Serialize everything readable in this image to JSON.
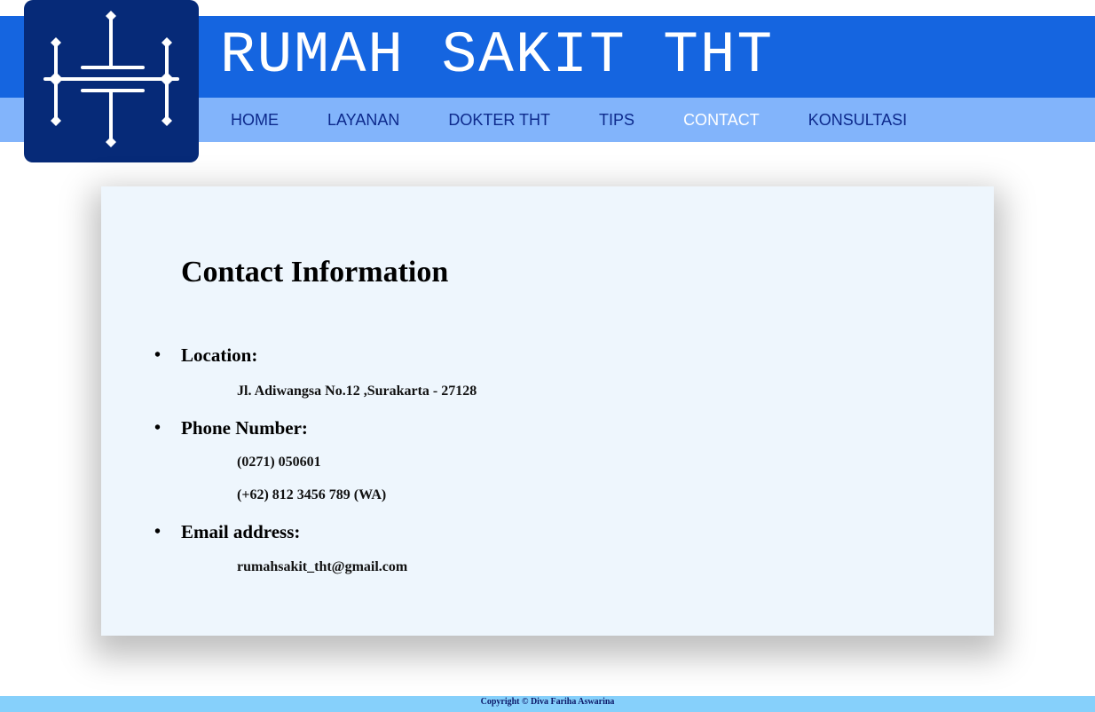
{
  "header": {
    "title": "RUMAH SAKIT THT",
    "logo_icon": "stylized-h-circuit-logo"
  },
  "nav": {
    "items": [
      "HOME",
      "LAYANAN",
      "DOKTER THT",
      "TIPS",
      "CONTACT",
      "KONSULTASI"
    ],
    "active": "CONTACT"
  },
  "contact": {
    "title": "Contact Information",
    "location_label": "Location:",
    "location_value": "Jl. Adiwangsa No.12 ,Surakarta - 27128",
    "phone_label": "Phone Number:",
    "phone_values": [
      "(0271) 050601",
      "(+62) 812 3456 789 (WA)"
    ],
    "email_label": "Email address:",
    "email_value": "rumahsakit_tht@gmail.com"
  },
  "footer": {
    "text": "Copyright © Diva Fariha Aswarina"
  },
  "colors": {
    "title_band": "#1565e0",
    "nav_band": "#82b4fb",
    "logo_bg": "#062a78",
    "card_bg": "#eef6fd",
    "footer_bg": "#86d0fb"
  }
}
